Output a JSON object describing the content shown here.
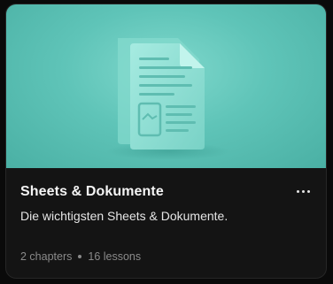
{
  "course": {
    "title": "Sheets & Dokumente",
    "description": "Die wichtigsten Sheets & Dokumente.",
    "chapters": "2 chapters",
    "lessons": "16 lessons"
  },
  "icons": {
    "hero": "document-icon",
    "more": "more-horizontal-icon"
  },
  "colors": {
    "hero_background": "#5fc4b8",
    "card_background": "#141414",
    "title": "#f5f5f5",
    "muted": "#8a8a8a"
  }
}
